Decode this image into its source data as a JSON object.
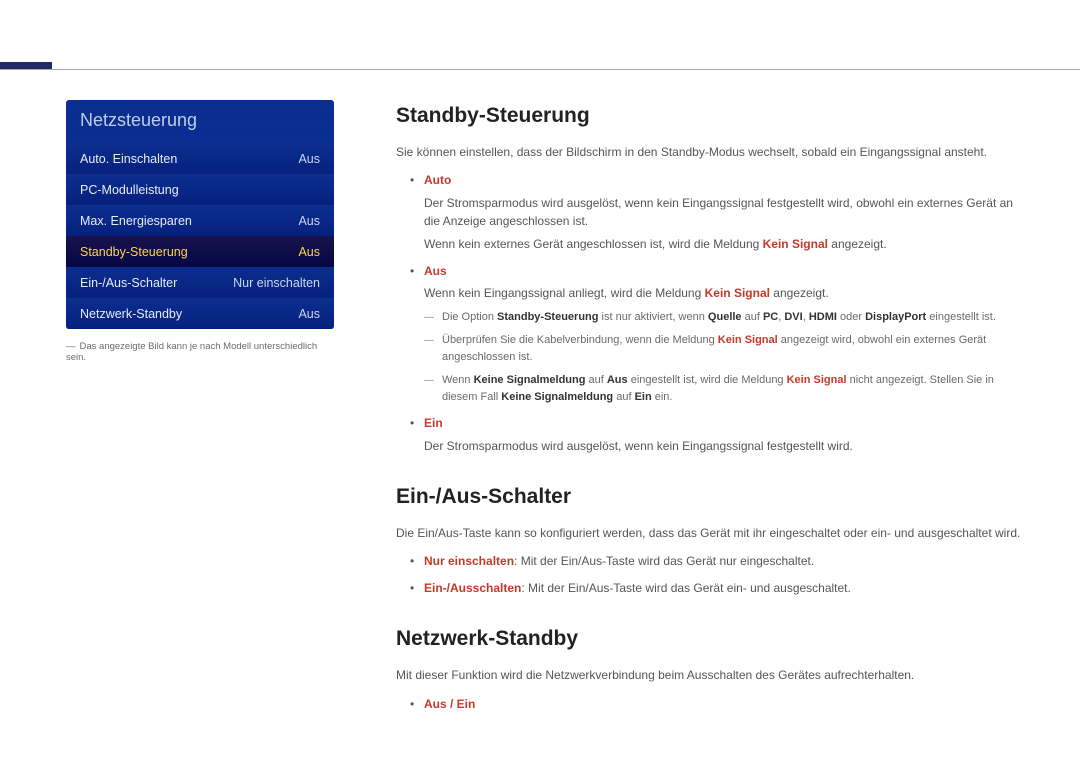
{
  "menu": {
    "title": "Netzsteuerung",
    "items": [
      {
        "label": "Auto. Einschalten",
        "value": "Aus"
      },
      {
        "label": "PC-Modulleistung",
        "value": ""
      },
      {
        "label": "Max. Energiesparen",
        "value": "Aus"
      },
      {
        "label": "Standby-Steuerung",
        "value": "Aus"
      },
      {
        "label": "Ein-/Aus-Schalter",
        "value": "Nur einschalten"
      },
      {
        "label": "Netzwerk-Standby",
        "value": "Aus"
      }
    ]
  },
  "note": "Das angezeigte Bild kann je nach Modell unterschiedlich sein.",
  "sec1": {
    "h": "Standby-Steuerung",
    "intro": "Sie können einstellen, dass der Bildschirm in den Standby-Modus wechselt, sobald ein Eingangssignal ansteht.",
    "auto_label": "Auto",
    "auto_p1": "Der Stromsparmodus wird ausgelöst, wenn kein Eingangssignal festgestellt wird, obwohl ein externes Gerät an die Anzeige angeschlossen ist.",
    "auto_p2a": "Wenn kein externes Gerät angeschlossen ist, wird die Meldung ",
    "kein_signal": "Kein Signal",
    "auto_p2b": " angezeigt.",
    "aus_label": "Aus",
    "aus_p_a": "Wenn kein Eingangssignal anliegt, wird die Meldung ",
    "aus_p_b": " angezeigt.",
    "aus_d1_a": "Die Option ",
    "aus_d1_b": " ist nur aktiviert, wenn ",
    "aus_d1_c": " auf ",
    "aus_d1_d": " oder ",
    "aus_d1_e": " eingestellt ist.",
    "quelle": "Quelle",
    "pc": "PC",
    "dvi": "DVI",
    "hdmi": "HDMI",
    "displayport": "DisplayPort",
    "aus_d2_a": "Überprüfen Sie die Kabelverbindung, wenn die Meldung ",
    "aus_d2_b": " angezeigt wird, obwohl ein externes Gerät angeschlossen ist.",
    "aus_d3_a": "Wenn ",
    "keine_signalmeldung": "Keine Signalmeldung",
    "aus_d3_b": " auf ",
    "aus_bold": "Aus",
    "aus_d3_c": " eingestellt ist, wird die Meldung ",
    "aus_d3_d": " nicht angezeigt. Stellen Sie in diesem Fall ",
    "aus_d3_e": " auf ",
    "ein_bold": "Ein",
    "aus_d3_f": " ein.",
    "ein_label": "Ein",
    "ein_p": "Der Stromsparmodus wird ausgelöst, wenn kein Eingangssignal festgestellt wird."
  },
  "sec2": {
    "h": "Ein-/Aus-Schalter",
    "intro": "Die Ein/Aus-Taste kann so konfiguriert werden, dass das Gerät mit ihr eingeschaltet oder ein- und ausgeschaltet wird.",
    "i1_label": "Nur einschalten",
    "i1_text": ": Mit der Ein/Aus-Taste wird das Gerät nur eingeschaltet.",
    "i2_label": "Ein-/Ausschalten",
    "i2_text": ": Mit der Ein/Aus-Taste wird das Gerät ein- und ausgeschaltet."
  },
  "sec3": {
    "h": "Netzwerk-Standby",
    "intro": "Mit dieser Funktion wird die Netzwerkverbindung beim Ausschalten des Gerätes aufrechterhalten.",
    "opt": "Aus / Ein"
  }
}
